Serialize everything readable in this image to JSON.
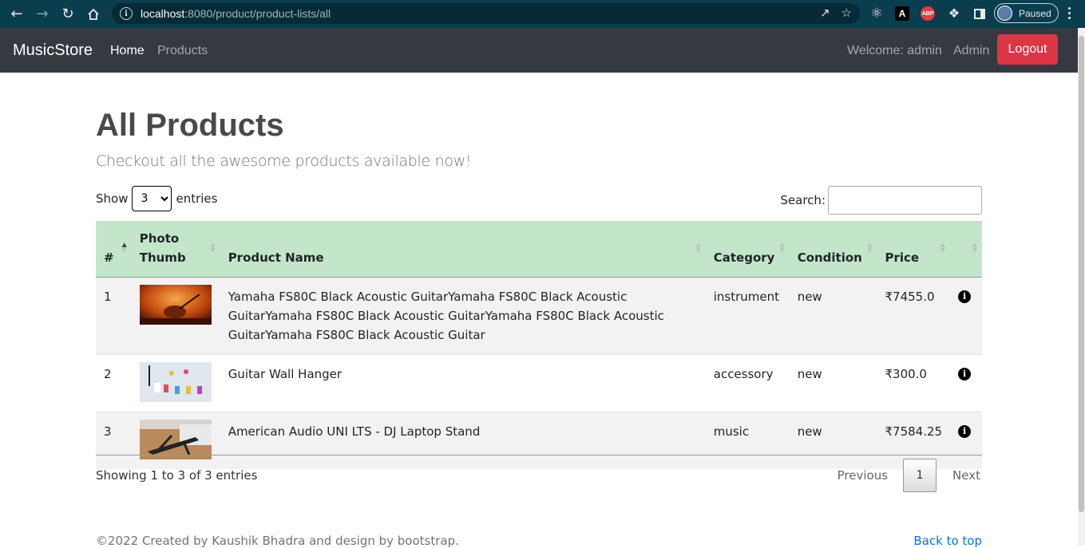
{
  "browser": {
    "url_host": "localhost",
    "url_rest": ":8080/product/product-lists/all",
    "profile_label": "Paused",
    "extensions": {
      "angular": "A",
      "abp": "ABP"
    }
  },
  "navbar": {
    "brand": "MusicStore",
    "links": [
      "Home",
      "Products"
    ],
    "welcome": "Welcome: admin",
    "admin": "Admin",
    "logout": "Logout"
  },
  "page": {
    "title": "All Products",
    "lead": "Checkout all the awesome products available now!"
  },
  "table_controls": {
    "show_label": "Show",
    "entries_value": "3",
    "entries_label": "entries",
    "search_label": "Search:",
    "search_value": ""
  },
  "table": {
    "headers": [
      "#",
      "Photo Thumb",
      "Product Name",
      "Category",
      "Condition",
      "Price",
      ""
    ],
    "rows": [
      {
        "num": "1",
        "name": "Yamaha FS80C Black Acoustic GuitarYamaha FS80C Black Acoustic GuitarYamaha FS80C Black Acoustic GuitarYamaha FS80C Black Acoustic GuitarYamaha FS80C Black Acoustic Guitar",
        "category": "instrument",
        "condition": "new",
        "price": "₹7455.0"
      },
      {
        "num": "2",
        "name": "Guitar Wall Hanger",
        "category": "accessory",
        "condition": "new",
        "price": "₹300.0"
      },
      {
        "num": "3",
        "name": "American Audio UNI LTS - DJ Laptop Stand",
        "category": "music",
        "condition": "new",
        "price": "₹7584.25"
      }
    ]
  },
  "pagination": {
    "info": "Showing 1 to 3 of 3 entries",
    "previous": "Previous",
    "current_page": "1",
    "next": "Next"
  },
  "footer": {
    "text": "©2022 Created by Kaushik Bhadra and design by bootstrap.",
    "back_to_top": "Back to top"
  }
}
